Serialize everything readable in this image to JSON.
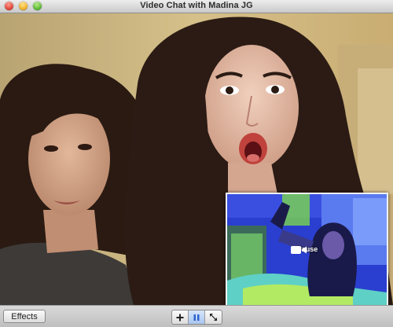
{
  "window": {
    "title": "Video Chat with Madina JG"
  },
  "pip": {
    "pause_label": "Pause",
    "pause_icon": "video-camera-icon"
  },
  "toolbar": {
    "effects_label": "Effects",
    "controls": [
      {
        "name": "add-participant-button",
        "icon": "plus-icon"
      },
      {
        "name": "pause-button",
        "icon": "pause-icon",
        "active": true
      },
      {
        "name": "fullscreen-button",
        "icon": "expand-icon"
      }
    ]
  },
  "colors": {
    "titlebar": "#d6d6d6",
    "close": "#e1473b",
    "minimize": "#f0b22c",
    "zoom": "#5cb935",
    "pause_active": "#3a6fd8"
  }
}
